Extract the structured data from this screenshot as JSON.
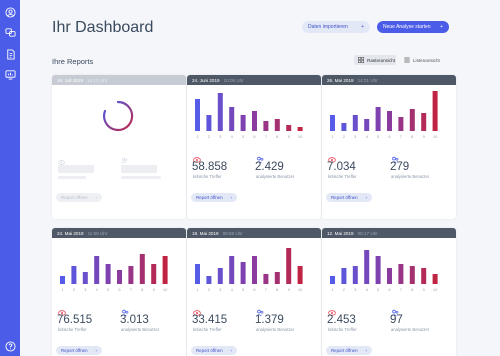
{
  "header": {
    "title": "Ihr Dashboard",
    "import_label": "Daten importieren",
    "new_label": "Neue Analyse starten",
    "plus": "+"
  },
  "reports": {
    "title": "Ihre Reports",
    "view_grid": "Rasteransicht",
    "view_list": "Listenansicht"
  },
  "labels": {
    "hits": "kritische Treffer",
    "users": "analysierte Benutzer",
    "open": "Report öffnen",
    "chevron": "›"
  },
  "colors": {
    "accent": "#4a5ce8",
    "sidebar": "#4a5ce8",
    "hits_icon": "#e74c5a",
    "users_icon": "#4a5ce8"
  },
  "cards": [
    {
      "date": "16. Juli 2019",
      "time": "16:12 Uhr",
      "loading": true
    },
    {
      "date": "24. Juni 2019",
      "time": "10:05 Uhr",
      "hits": "58.858",
      "users": "2.429"
    },
    {
      "date": "26. Mai 2019",
      "time": "14:31 Uhr",
      "hits": "7.034",
      "users": "279"
    },
    {
      "date": "24. Mai 2019",
      "time": "11:59 Uhr",
      "hits": "76.515",
      "users": "3.013"
    },
    {
      "date": "18. Mai 2019",
      "time": "09:58 Uhr",
      "hits": "33.415",
      "users": "1.379"
    },
    {
      "date": "12. Mai 2019",
      "time": "08:17 Uhr",
      "hits": "2.453",
      "users": "97"
    }
  ],
  "chart_data": [
    {
      "type": "bar",
      "categories": [
        "1",
        "2",
        "3",
        "4",
        "5",
        "6",
        "7",
        "8",
        "9",
        "10"
      ],
      "values": [
        80,
        40,
        95,
        60,
        40,
        50,
        25,
        30,
        15,
        10
      ],
      "ylim": [
        0,
        100
      ]
    },
    {
      "type": "bar",
      "categories": [
        "1",
        "2",
        "3",
        "4",
        "5",
        "6",
        "7",
        "8",
        "9",
        "10"
      ],
      "values": [
        40,
        20,
        40,
        30,
        60,
        50,
        35,
        55,
        45,
        100
      ],
      "ylim": [
        0,
        100
      ]
    },
    {
      "type": "bar",
      "categories": [
        "1",
        "2",
        "3",
        "4",
        "5",
        "6",
        "7",
        "8",
        "9",
        "10"
      ],
      "values": [
        20,
        45,
        30,
        70,
        50,
        35,
        45,
        75,
        50,
        70
      ],
      "ylim": [
        0,
        100
      ]
    },
    {
      "type": "bar",
      "categories": [
        "1",
        "2",
        "3",
        "4",
        "5",
        "6",
        "7",
        "8",
        "9",
        "10"
      ],
      "values": [
        50,
        20,
        40,
        70,
        55,
        70,
        25,
        30,
        90,
        45
      ],
      "ylim": [
        0,
        100
      ]
    },
    {
      "type": "bar",
      "categories": [
        "1",
        "2",
        "3",
        "4",
        "5",
        "6",
        "7",
        "8",
        "9",
        "10"
      ],
      "values": [
        20,
        40,
        45,
        85,
        70,
        40,
        50,
        45,
        40,
        25
      ],
      "ylim": [
        0,
        100
      ]
    }
  ]
}
